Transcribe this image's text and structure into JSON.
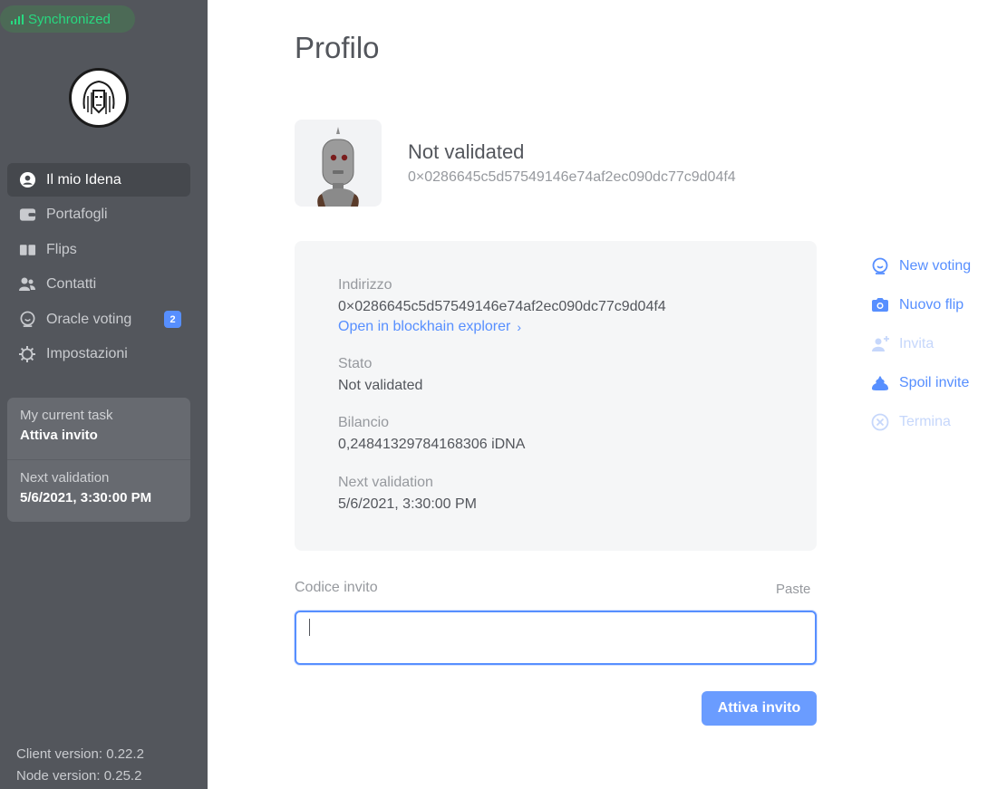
{
  "sync": {
    "label": "Synchronized",
    "color": "#27d980"
  },
  "sidebar": {
    "items": [
      {
        "label": "Il mio Idena",
        "icon": "user-circle-icon",
        "active": true
      },
      {
        "label": "Portafogli",
        "icon": "wallet-icon"
      },
      {
        "label": "Flips",
        "icon": "flips-icon"
      },
      {
        "label": "Contatti",
        "icon": "contacts-icon"
      },
      {
        "label": "Oracle voting",
        "icon": "oracle-icon",
        "badge": "2"
      },
      {
        "label": "Impostazioni",
        "icon": "gear-icon"
      }
    ],
    "task": {
      "current_label": "My current task",
      "current_value": "Attiva invito",
      "next_label": "Next validation",
      "next_value": "5/6/2021, 3:30:00 PM"
    },
    "versions": {
      "client": "Client version: 0.22.2",
      "node": "Node version: 0.25.2"
    }
  },
  "main": {
    "title": "Profilo",
    "profile": {
      "state": "Not validated",
      "address": "0×0286645c5d57549146e74af2ec090dc77c9d04f4"
    },
    "details": {
      "address_label": "Indirizzo",
      "address_value": "0×0286645c5d57549146e74af2ec090dc77c9d04f4",
      "explorer_link": "Open in blockhain explorer",
      "status_label": "Stato",
      "status_value": "Not validated",
      "balance_label": "Bilancio",
      "balance_value": "0,24841329784168306 iDNA",
      "next_label": "Next validation",
      "next_value": "5/6/2021, 3:30:00 PM"
    },
    "actions": [
      {
        "label": "New voting",
        "icon": "oracle-icon",
        "enabled": true
      },
      {
        "label": "Nuovo flip",
        "icon": "camera-icon",
        "enabled": true
      },
      {
        "label": "Invita",
        "icon": "add-user-icon",
        "enabled": false
      },
      {
        "label": "Spoil invite",
        "icon": "spoil-icon",
        "enabled": true
      },
      {
        "label": "Termina",
        "icon": "terminate-icon",
        "enabled": false
      }
    ],
    "invite": {
      "label": "Codice invito",
      "paste": "Paste",
      "value": "",
      "button": "Attiva invito"
    }
  },
  "colors": {
    "sidebar_bg": "#53565c",
    "accent": "#578fff",
    "sync_green": "#27d980"
  }
}
